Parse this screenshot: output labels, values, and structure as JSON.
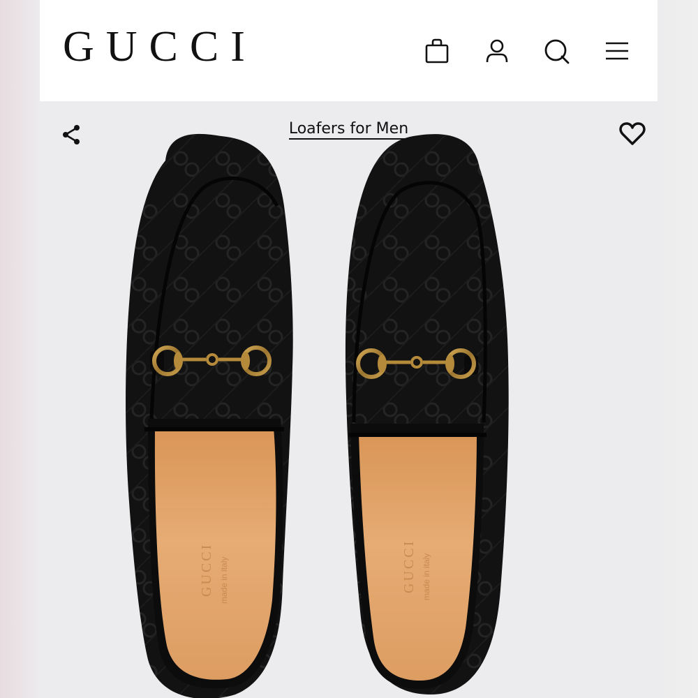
{
  "brand": {
    "logo_text": "GUCCI"
  },
  "header": {
    "icons": [
      "shopping-bag-icon",
      "user-icon",
      "search-icon",
      "menu-icon"
    ]
  },
  "product_page": {
    "category_title": "Loafers for Men",
    "share_icon": "share-icon",
    "wishlist_icon": "heart-icon",
    "image_alt": "Black velvet GG horsebit loafers, top view",
    "insole_text_1": "GUCCI",
    "insole_text_2": "made in italy"
  },
  "colors": {
    "header_bg": "#ffffff",
    "page_bg": "#ececee",
    "text": "#111111",
    "velvet": "#121212",
    "insole": "#e0a56b",
    "hardware": "#b58a3a"
  }
}
